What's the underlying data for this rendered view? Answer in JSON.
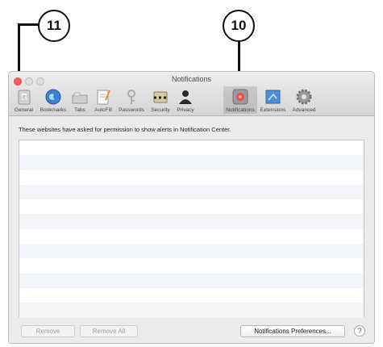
{
  "callouts": {
    "left": "11",
    "right": "10"
  },
  "window": {
    "title": "Notifications"
  },
  "toolbar": {
    "items": [
      {
        "label": "General",
        "icon": "general-icon"
      },
      {
        "label": "Bookmarks",
        "icon": "bookmarks-icon"
      },
      {
        "label": "Tabs",
        "icon": "tabs-icon"
      },
      {
        "label": "AutoFill",
        "icon": "autofill-icon"
      },
      {
        "label": "Passwords",
        "icon": "passwords-icon"
      },
      {
        "label": "Security",
        "icon": "security-icon"
      },
      {
        "label": "Privacy",
        "icon": "privacy-icon"
      },
      {
        "label": "Notifications",
        "icon": "notifications-icon",
        "selected": true
      },
      {
        "label": "Extensions",
        "icon": "extensions-icon"
      },
      {
        "label": "Advanced",
        "icon": "advanced-icon"
      }
    ]
  },
  "content": {
    "info_text": "These websites have asked for permission to show alerts in Notification Center."
  },
  "buttons": {
    "remove": "Remove",
    "remove_all": "Remove All",
    "notifications_preferences": "Notifications Preferences...",
    "help": "?"
  },
  "colors": {
    "close": "#fc5f57",
    "inactive_light": "#dcdcdc",
    "selected_tab": "#c9c9c9",
    "alt_row": "#f2f5fa"
  }
}
